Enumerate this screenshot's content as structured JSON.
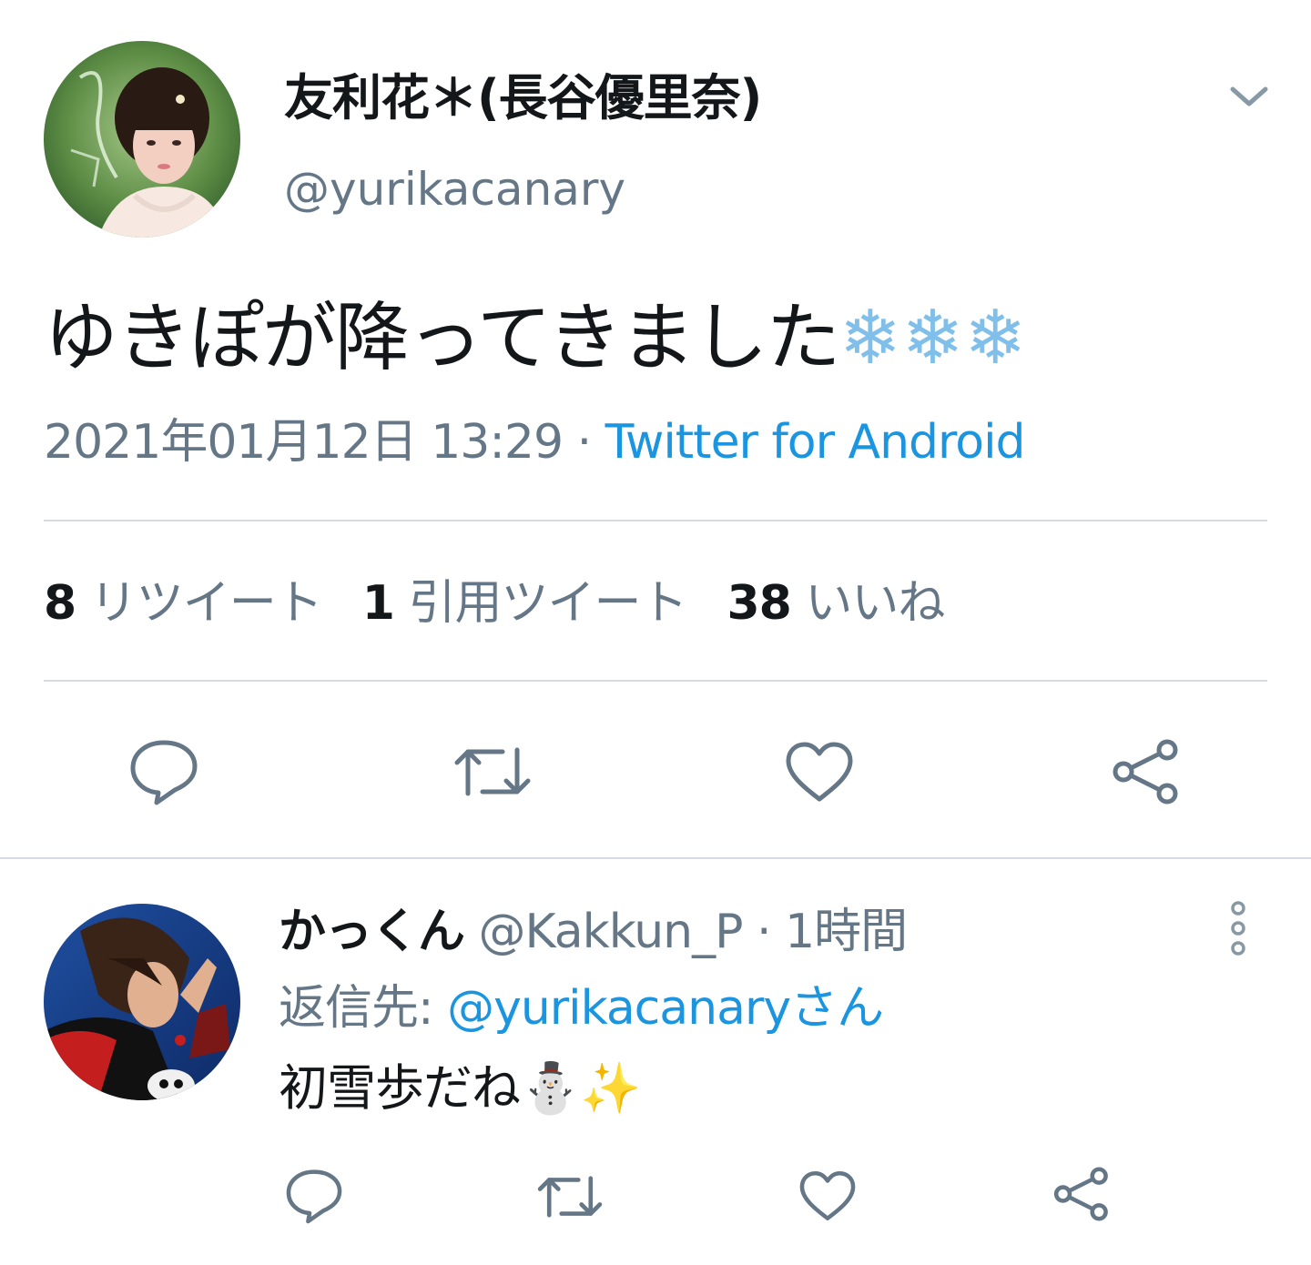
{
  "tweet": {
    "author_name": "友利花＊(長谷優里奈)",
    "author_handle": "@yurikacanary",
    "text": "ゆきぽが降ってきました",
    "emoji": "❄❄❄",
    "timestamp": "2021年01月12日 13:29",
    "meta_separator": " · ",
    "source": "Twitter for Android",
    "retweet_count": "8",
    "retweet_label": "リツイート",
    "quote_count": "1",
    "quote_label": "引用ツイート",
    "like_count": "38",
    "like_label": "いいね"
  },
  "reply": {
    "author_name": "かっくん",
    "author_handle": "@Kakkun_P",
    "time_separator": " · ",
    "time": "1時間",
    "reply_to_label": "返信先: ",
    "reply_to_mention": "@yurikacanaryさん",
    "text": "初雪歩だね",
    "emoji": "⛄✨"
  },
  "icons": {
    "caret": "chevron-down-icon",
    "reply": "reply-bubble-icon",
    "retweet": "retweet-icon",
    "like": "heart-icon",
    "share": "share-icon",
    "more": "more-vertical-icon"
  },
  "colors": {
    "text": "#14171a",
    "secondary": "#657786",
    "link": "#1b95e0",
    "divider": "#d5dbe0"
  }
}
